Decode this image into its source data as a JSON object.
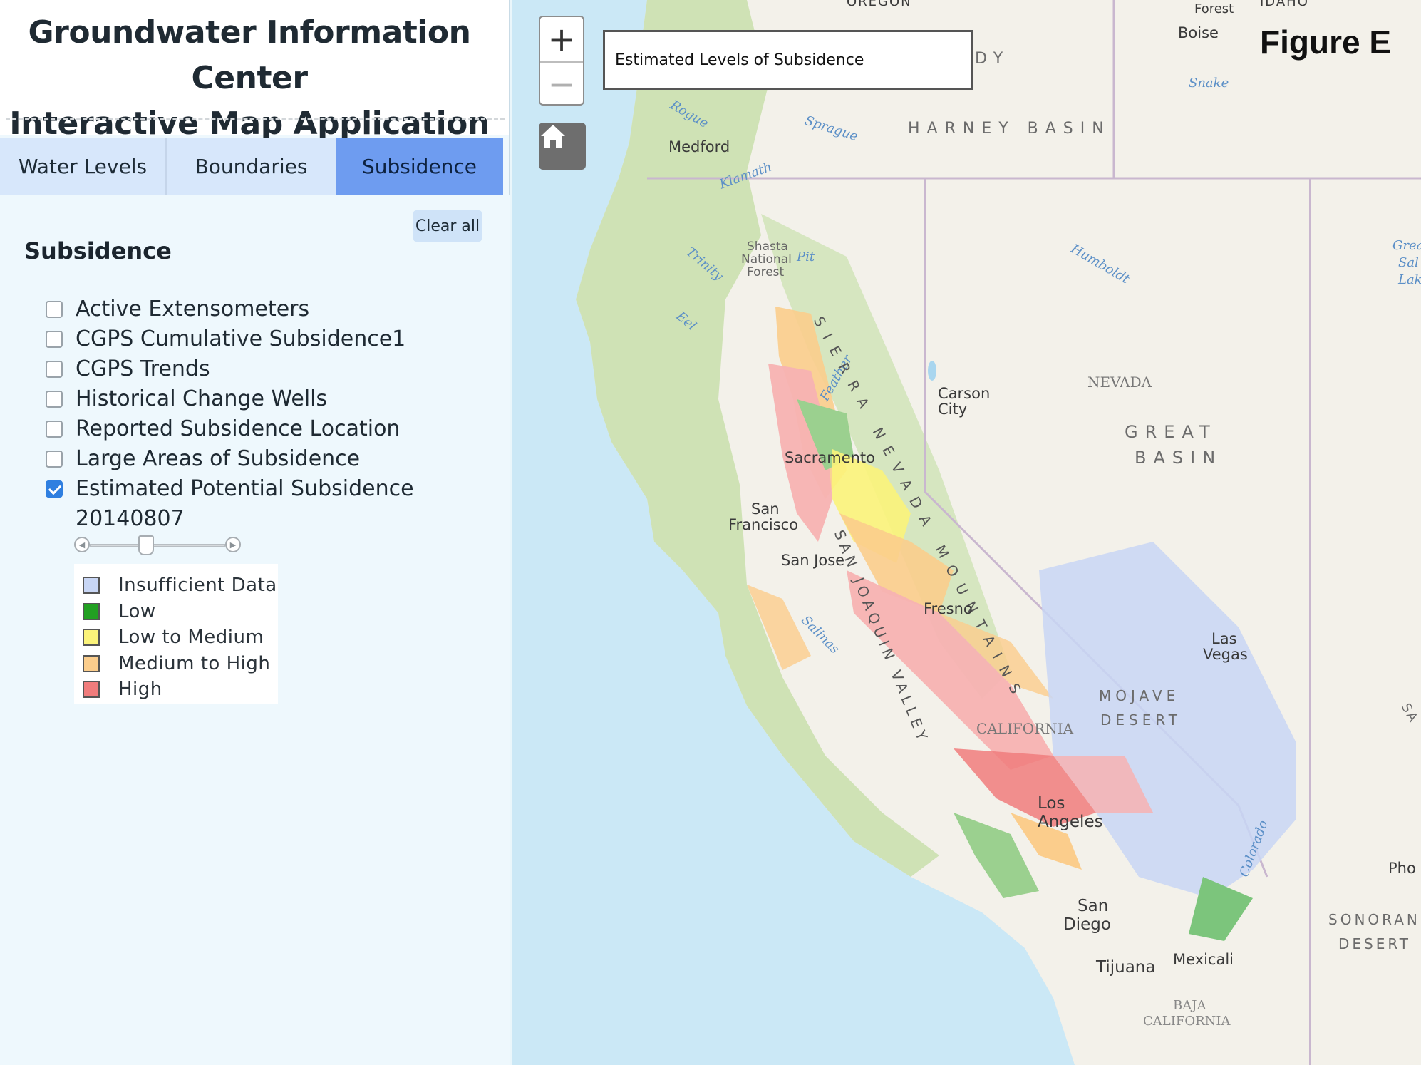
{
  "app": {
    "title_line1": "Groundwater Information Center",
    "title_line2": "Interactive Map Application"
  },
  "tabs": [
    {
      "label": "Water Levels",
      "active": false
    },
    {
      "label": "Boundaries",
      "active": false
    },
    {
      "label": "Subsidence",
      "active": true
    }
  ],
  "panel": {
    "clear_label": "Clear all",
    "section_title": "Subsidence",
    "layers": [
      {
        "label": "Active Extensometers",
        "checked": false
      },
      {
        "label": "CGPS Cumulative Subsidence1",
        "checked": false
      },
      {
        "label": "CGPS Trends",
        "checked": false
      },
      {
        "label": "Historical Change Wells",
        "checked": false
      },
      {
        "label": "Reported Subsidence Location",
        "checked": false
      },
      {
        "label": "Large Areas of Subsidence",
        "checked": false
      },
      {
        "label": "Estimated Potential Subsidence 20140807",
        "checked": true
      }
    ],
    "legend": [
      {
        "label": "Insufficient Data",
        "color": "#c8d6f5"
      },
      {
        "label": "Low",
        "color": "#22a022"
      },
      {
        "label": "Low to Medium",
        "color": "#fbf37a"
      },
      {
        "label": "Medium to High",
        "color": "#fbcd8c"
      },
      {
        "label": "High",
        "color": "#f07c7c"
      }
    ]
  },
  "map": {
    "zoom_in": "+",
    "zoom_out": "−",
    "home_icon": "home-icon",
    "title_box": "Estimated Levels of Subsidence",
    "figure_label": "Figure E",
    "labels": {
      "oregon": "OREGON",
      "idaho": "IDAHO",
      "forest": "Forest",
      "boise": "Boise",
      "snake": "Snake",
      "harney_basin": "HARNEY BASIN",
      "dy": "DY",
      "medford": "Medford",
      "rogue": "Rogue",
      "sprague": "Sprague",
      "klamath": "Klamath",
      "shasta": "Shasta",
      "national": "National",
      "forest2": "Forest",
      "trinity": "Trinity",
      "pit": "Pit",
      "eel": "Eel",
      "humboldt": "Humboldt",
      "nevada": "NEVADA",
      "great": "GREAT",
      "basin": "BASIN",
      "carson": "Carson",
      "city": "City",
      "sierra_nevada": "SIERRA NEVADA MOUNTAINS",
      "sacramento": "Sacramento",
      "san": "San",
      "francisco": "Francisco",
      "san_jose": "San Jose",
      "san_joaquin_valley": "SAN JOAQUIN VALLEY",
      "fresno": "Fresno",
      "salinas": "Salinas",
      "feather": "Feather",
      "las": "Las",
      "vegas": "Vegas",
      "mojave": "MOJAVE",
      "desert": "DESERT",
      "california": "CALIFORNIA",
      "los": "Los",
      "angeles": "Angeles",
      "san2": "San",
      "diego": "Diego",
      "tijuana": "Tijuana",
      "mexicali": "Mexicali",
      "baja": "BAJA",
      "california2": "CALIFORNIA",
      "sonoran": "SONORAN",
      "desert2": "DESERT",
      "pho": "Pho",
      "great_salt": "Grea",
      "salt": "Sal",
      "lake": "Lak",
      "sa": "SA",
      "colorado": "Colorado"
    }
  }
}
